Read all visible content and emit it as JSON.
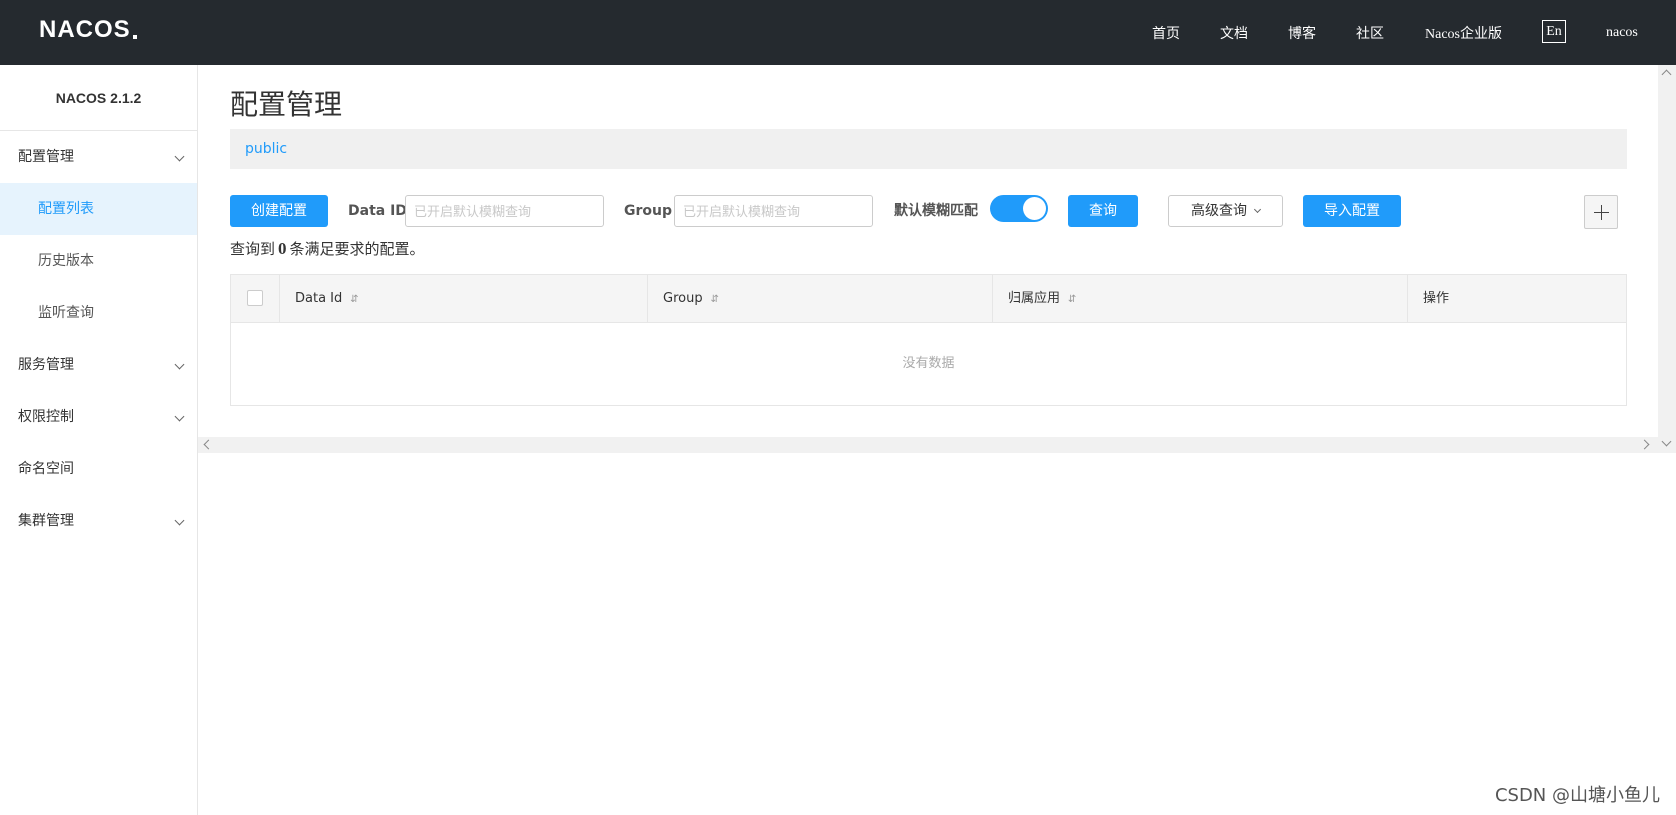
{
  "header": {
    "logo": "NACOS",
    "nav": [
      "首页",
      "文档",
      "博客",
      "社区",
      "Nacos企业版"
    ],
    "lang_button": "En",
    "user": "nacos"
  },
  "sidebar": {
    "version": "NACOS 2.1.2",
    "groups": [
      {
        "label": "配置管理",
        "expandable": true,
        "items": [
          {
            "label": "配置列表",
            "active": true
          },
          {
            "label": "历史版本",
            "active": false
          },
          {
            "label": "监听查询",
            "active": false
          }
        ]
      },
      {
        "label": "服务管理",
        "expandable": true
      },
      {
        "label": "权限控制",
        "expandable": true
      },
      {
        "label": "命名空间",
        "expandable": false
      },
      {
        "label": "集群管理",
        "expandable": true
      }
    ]
  },
  "main": {
    "title": "配置管理",
    "namespace": "public",
    "create_button": "创建配置",
    "data_id_label": "Data ID",
    "data_id_placeholder": "已开启默认模糊查询",
    "group_label": "Group",
    "group_placeholder": "已开启默认模糊查询",
    "fuzzy_label": "默认模糊匹配",
    "fuzzy_enabled": true,
    "query_button": "查询",
    "advanced_button": "高级查询",
    "import_button": "导入配置",
    "result_prefix": "查询到",
    "result_count": "0",
    "result_suffix": "条满足要求的配置。",
    "table": {
      "columns": [
        "Data Id",
        "Group",
        "归属应用",
        "操作"
      ],
      "sort_icon": "⇵",
      "empty_text": "没有数据"
    }
  },
  "watermark": "CSDN @山塘小鱼儿",
  "colors": {
    "topbar": "#252a2f",
    "accent": "#209bfa",
    "active_bg": "#e6f3fd"
  }
}
